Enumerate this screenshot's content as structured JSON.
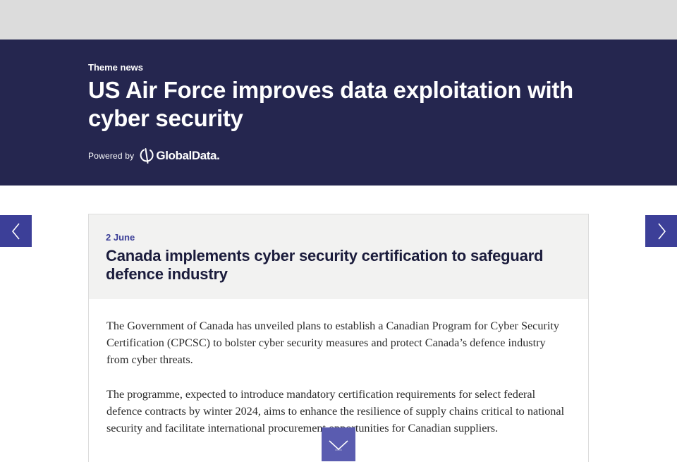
{
  "hero": {
    "eyebrow": "Theme news",
    "title": "US Air Force improves data exploitation with cyber security",
    "powered_by_label": "Powered by",
    "logo_text": "GlobalData."
  },
  "article": {
    "date": "2 June",
    "title": "Canada implements cyber security certification to safeguard defence industry",
    "paragraphs": [
      "The Government of Canada has unveiled plans to establish a Canadian Program for Cyber Security Certification (CPCSC) to bolster cyber security measures and protect Canada’s defence industry from cyber threats.",
      "The programme, expected to introduce mandatory certification requirements for select federal defence contracts by winter 2024, aims to enhance the resilience of supply chains critical to national security and facilitate international procurement opportunities for Canadian suppliers."
    ]
  },
  "icons": {
    "prev": "chevron-left-icon",
    "next": "chevron-right-icon",
    "scroll": "chevron-down-icon",
    "logo": "globaldata-logo-icon"
  },
  "colors": {
    "hero_background": "#25264f",
    "accent": "#3c3f98",
    "scroll_button": "#5a5cb0",
    "card_header_background": "#f2f2f1"
  }
}
